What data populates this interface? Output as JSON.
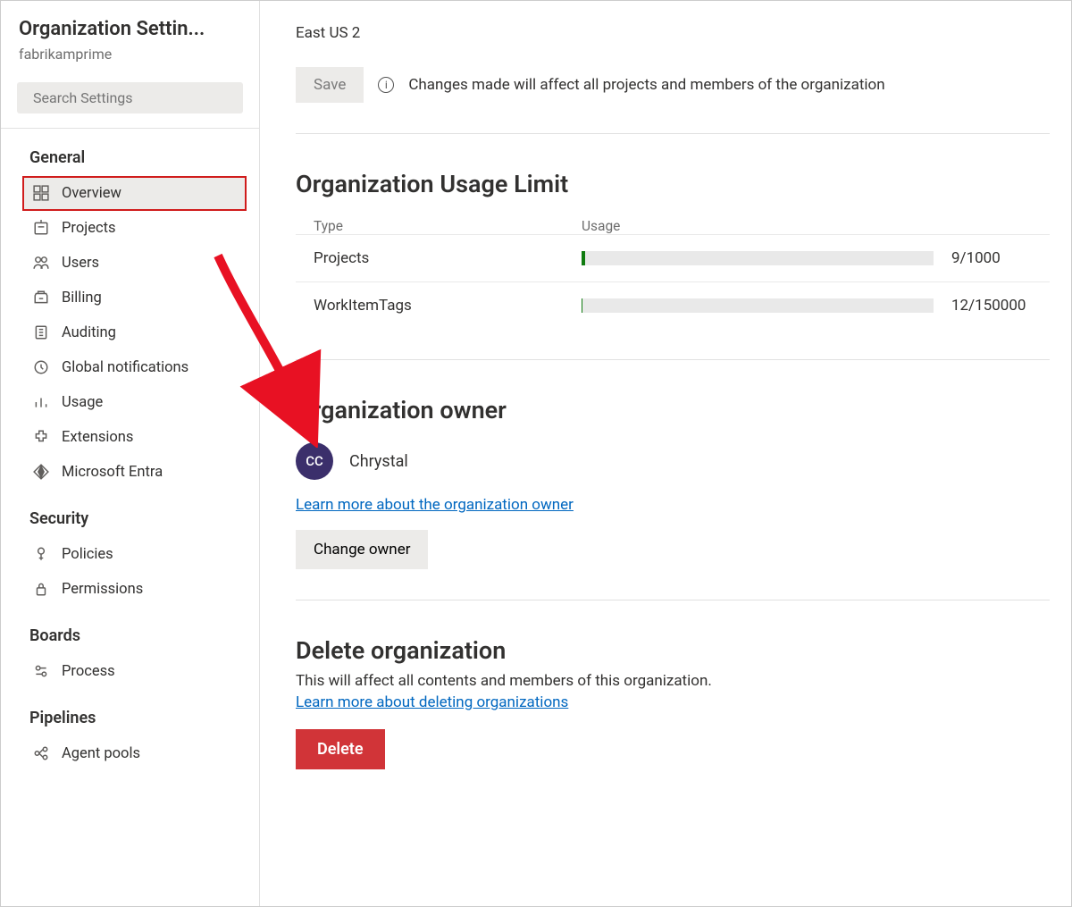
{
  "sidebar": {
    "title": "Organization Settin...",
    "subtitle": "fabrikamprime",
    "search_placeholder": "Search Settings",
    "groups": [
      {
        "label": "General",
        "items": [
          {
            "icon": "overview-icon",
            "label": "Overview",
            "active": true
          },
          {
            "icon": "projects-icon",
            "label": "Projects"
          },
          {
            "icon": "users-icon",
            "label": "Users"
          },
          {
            "icon": "billing-icon",
            "label": "Billing"
          },
          {
            "icon": "auditing-icon",
            "label": "Auditing"
          },
          {
            "icon": "notification-icon",
            "label": "Global notifications"
          },
          {
            "icon": "usage-icon",
            "label": "Usage"
          },
          {
            "icon": "extensions-icon",
            "label": "Extensions"
          },
          {
            "icon": "entra-icon",
            "label": "Microsoft Entra"
          }
        ]
      },
      {
        "label": "Security",
        "items": [
          {
            "icon": "policies-icon",
            "label": "Policies"
          },
          {
            "icon": "permissions-icon",
            "label": "Permissions"
          }
        ]
      },
      {
        "label": "Boards",
        "items": [
          {
            "icon": "process-icon",
            "label": "Process"
          }
        ]
      },
      {
        "label": "Pipelines",
        "items": [
          {
            "icon": "agentpools-icon",
            "label": "Agent pools"
          }
        ]
      }
    ]
  },
  "main": {
    "region": "East US 2",
    "save_label": "Save",
    "save_info": "Changes made will affect all projects and members of the organization",
    "usage": {
      "title": "Organization Usage Limit",
      "head_type": "Type",
      "head_usage": "Usage",
      "rows": [
        {
          "type": "Projects",
          "used": 9,
          "limit": 1000,
          "display": "9/1000"
        },
        {
          "type": "WorkItemTags",
          "used": 12,
          "limit": 150000,
          "display": "12/150000"
        }
      ]
    },
    "owner": {
      "title": "Organization owner",
      "initials": "CC",
      "name": "Chrystal",
      "learn_link": "Learn more about the organization owner",
      "change_btn": "Change owner"
    },
    "delete": {
      "title": "Delete organization",
      "desc": "This will affect all contents and members of this organization.",
      "learn_link": "Learn more about deleting organizations",
      "btn": "Delete"
    }
  }
}
